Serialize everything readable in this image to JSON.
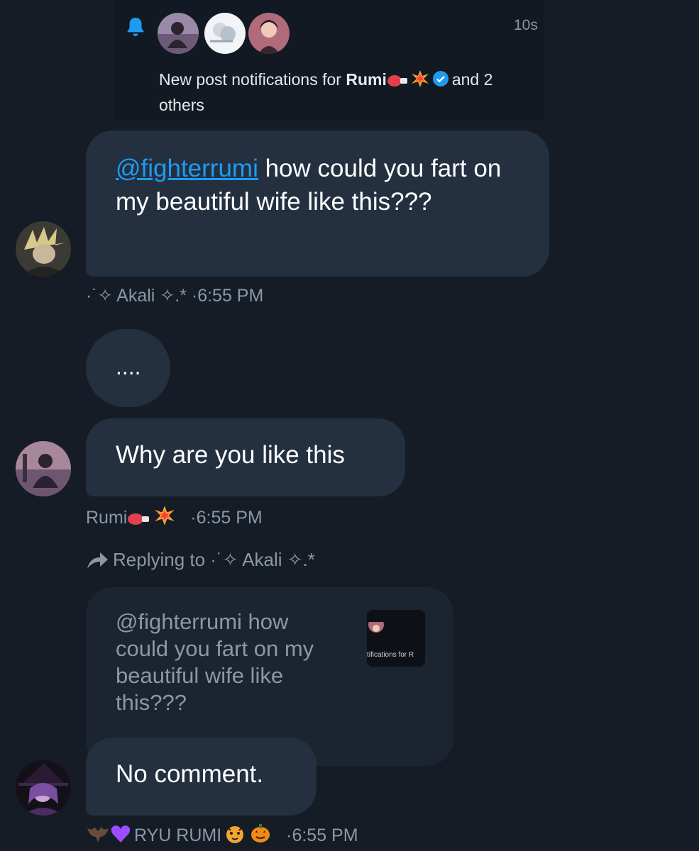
{
  "notification": {
    "time": "10s",
    "text_prefix": "New post notifications for ",
    "name": "Rumi",
    "text_suffix": "and 2",
    "text_line2": "others"
  },
  "messages": [
    {
      "mention": "@fighterrumi",
      "text": " how could you fart on my beautiful wife like this???",
      "sender": "·˙✧ Akali ✧.*",
      "time": "·6:55 PM"
    },
    {
      "text": "...."
    },
    {
      "text": "Why are you like this",
      "sender": "Rumi",
      "time": "·6:55 PM"
    }
  ],
  "reply": {
    "label": "Replying to ·˙✧ Akali ✧.*",
    "quoted_text": "@fighterrumi how could you fart on my beautiful wife like this???",
    "thumb_text": "tifications for R",
    "text": "No comment.",
    "sender": "RYU RUMI",
    "time": "·6:55 PM"
  },
  "colors": {
    "background": "#151c26",
    "bubble": "#243040",
    "mention": "#1d9bf0",
    "bell": "#1d9bf0",
    "muted": "#8b98a5"
  },
  "icons": [
    "bell-icon",
    "verified-badge-icon",
    "boxing-glove-icon",
    "collision-icon",
    "reply-arrow-icon",
    "bat-icon",
    "purple-heart-icon",
    "tiger-icon",
    "pumpkin-icon"
  ]
}
